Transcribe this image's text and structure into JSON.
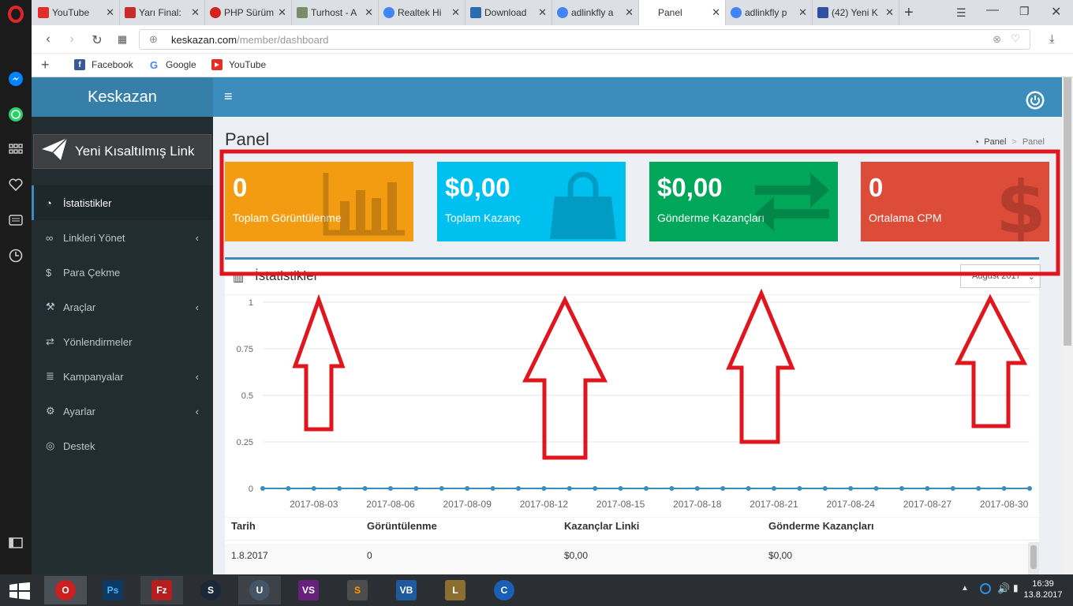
{
  "browser": {
    "tabs": [
      {
        "label": "YouTube",
        "color": "#e52d27"
      },
      {
        "label": "Yarı Final:",
        "color": "#cc2b2b"
      },
      {
        "label": "PHP Sürüm",
        "color": "#d52020"
      },
      {
        "label": "Turhost - A",
        "color": "#7a8b6a"
      },
      {
        "label": "Realtek Hi",
        "color": "#4285f4"
      },
      {
        "label": "Download",
        "color": "#2b6cb0"
      },
      {
        "label": "adlinkfly a",
        "color": "#4285f4"
      },
      {
        "label": "Panel",
        "color": "#ffffff"
      },
      {
        "label": "adlinkfly p",
        "color": "#4285f4"
      },
      {
        "label": "(42) Yeni K",
        "color": "#2f4fa0"
      }
    ],
    "url_host": "keskazan.com",
    "url_path": "/member/dashboard",
    "bookmarks": [
      {
        "label": "Facebook",
        "icon": "facebook-icon"
      },
      {
        "label": "Google",
        "icon": "google-icon"
      },
      {
        "label": "YouTube",
        "icon": "youtube-icon"
      }
    ]
  },
  "app": {
    "brand": "Keskazan",
    "new_link": "Yeni Kısaltılmış Link",
    "menu": [
      {
        "label": "İstatistikler",
        "icon": "dashboard-icon",
        "chevron": false
      },
      {
        "label": "Linkleri Yönet",
        "icon": "link-icon",
        "chevron": true
      },
      {
        "label": "Para Çekme",
        "icon": "dollar-icon",
        "chevron": false
      },
      {
        "label": "Araçlar",
        "icon": "wrench-icon",
        "chevron": true
      },
      {
        "label": "Yönlendirmeler",
        "icon": "exchange-icon",
        "chevron": false
      },
      {
        "label": "Kampanyalar",
        "icon": "database-icon",
        "chevron": true
      },
      {
        "label": "Ayarlar",
        "icon": "cogs-icon",
        "chevron": true
      },
      {
        "label": "Destek",
        "icon": "support-icon",
        "chevron": false
      }
    ],
    "page_title": "Panel",
    "breadcrumb": [
      "Panel",
      "Panel"
    ],
    "stat_boxes": [
      {
        "value": "0",
        "label": "Toplam Görüntülenme",
        "color": "#f39c12",
        "icon": "bar-chart-icon"
      },
      {
        "value": "$0,00",
        "label": "Toplam Kazanç",
        "color": "#00c0ef",
        "icon": "shopping-bag-icon"
      },
      {
        "value": "$0,00",
        "label": "Gönderme Kazançları",
        "color": "#00a65a",
        "icon": "exchange-icon"
      },
      {
        "value": "0",
        "label": "Ortalama CPM",
        "color": "#dd4b39",
        "icon": "dollar-icon"
      }
    ],
    "stats_title": "İstatistikler",
    "month_select": "August 2017",
    "table_headers": [
      "Tarih",
      "Görüntülenme",
      "Kazançlar Linki",
      "Gönderme Kazançları"
    ],
    "table_rows": [
      [
        "1.8.2017",
        "0",
        "$0,00",
        "$0,00"
      ]
    ]
  },
  "chart_data": {
    "type": "line",
    "ylim": [
      0,
      1
    ],
    "yticks": [
      "1",
      "0.75",
      "0.5",
      "0.25",
      "0"
    ],
    "xticks": [
      "2017-08-03",
      "2017-08-06",
      "2017-08-09",
      "2017-08-12",
      "2017-08-15",
      "2017-08-18",
      "2017-08-21",
      "2017-08-24",
      "2017-08-27",
      "2017-08-30"
    ],
    "x": [
      "2017-08-01",
      "2017-08-02",
      "2017-08-03",
      "2017-08-04",
      "2017-08-05",
      "2017-08-06",
      "2017-08-07",
      "2017-08-08",
      "2017-08-09",
      "2017-08-10",
      "2017-08-11",
      "2017-08-12",
      "2017-08-13",
      "2017-08-14",
      "2017-08-15",
      "2017-08-16",
      "2017-08-17",
      "2017-08-18",
      "2017-08-19",
      "2017-08-20",
      "2017-08-21",
      "2017-08-22",
      "2017-08-23",
      "2017-08-24",
      "2017-08-25",
      "2017-08-26",
      "2017-08-27",
      "2017-08-28",
      "2017-08-29",
      "2017-08-30",
      "2017-08-31"
    ],
    "values": [
      0,
      0,
      0,
      0,
      0,
      0,
      0,
      0,
      0,
      0,
      0,
      0,
      0,
      0,
      0,
      0,
      0,
      0,
      0,
      0,
      0,
      0,
      0,
      0,
      0,
      0,
      0,
      0,
      0,
      0,
      0
    ],
    "color": "#3c8dbc"
  },
  "taskbar": {
    "time": "16:39",
    "date": "13.8.2017",
    "apps": [
      {
        "name": "opera-app",
        "label": "O",
        "color": "#cc1f1f"
      },
      {
        "name": "photoshop-app",
        "label": "Ps",
        "color": "#0d3a62"
      },
      {
        "name": "filezilla-app",
        "label": "Fz",
        "color": "#b51e1e"
      },
      {
        "name": "steam-app",
        "label": "S",
        "color": "#1b2838"
      },
      {
        "name": "unity-app",
        "label": "U",
        "color": "#445566"
      },
      {
        "name": "visual-studio-app",
        "label": "VS",
        "color": "#68217a"
      },
      {
        "name": "sublime-app",
        "label": "S",
        "color": "#4d4d4d"
      },
      {
        "name": "virtualbox-app",
        "label": "VB",
        "color": "#1d5b9c"
      },
      {
        "name": "league-app",
        "label": "L",
        "color": "#8a6e2f"
      },
      {
        "name": "ccleaner-app",
        "label": "C",
        "color": "#1a5fb4"
      }
    ]
  }
}
